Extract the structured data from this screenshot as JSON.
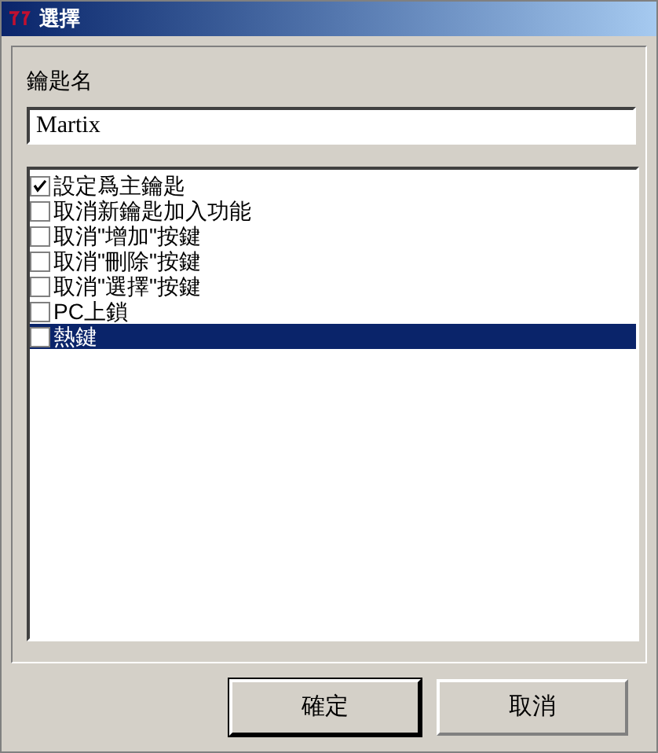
{
  "window": {
    "title": "選擇"
  },
  "key_name": {
    "label": "鑰匙名",
    "value": "Martix"
  },
  "options": [
    {
      "label": "設定爲主鑰匙",
      "checked": true,
      "selected": false
    },
    {
      "label": "取消新鑰匙加入功能",
      "checked": false,
      "selected": false
    },
    {
      "label": "取消\"增加\"按鍵",
      "checked": false,
      "selected": false
    },
    {
      "label": "取消\"刪除\"按鍵",
      "checked": false,
      "selected": false
    },
    {
      "label": "取消\"選擇\"按鍵",
      "checked": false,
      "selected": false
    },
    {
      "label": "PC上鎖",
      "checked": false,
      "selected": false
    },
    {
      "label": "熱鍵",
      "checked": false,
      "selected": true
    }
  ],
  "buttons": [
    {
      "label": "確定",
      "default": true
    },
    {
      "label": "取消",
      "default": false
    }
  ]
}
